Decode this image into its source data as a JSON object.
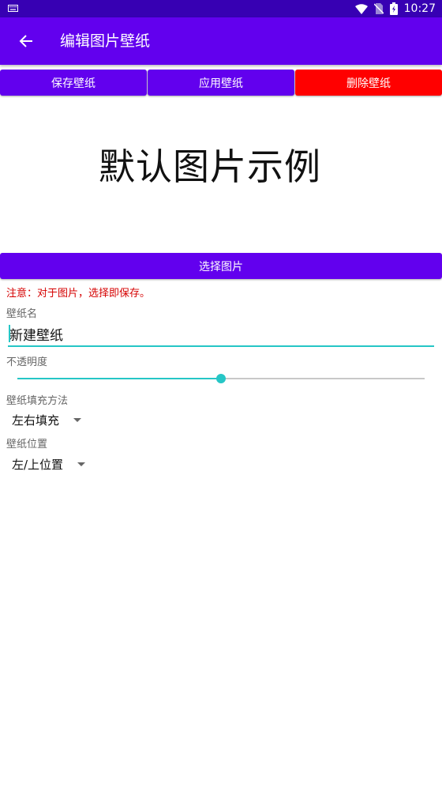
{
  "status_bar": {
    "time": "10:27",
    "icons": [
      "keyboard-icon",
      "wifi-icon",
      "no-sim-icon",
      "battery-icon"
    ]
  },
  "app_bar": {
    "title": "编辑图片壁纸",
    "back_icon": "arrow-left-icon"
  },
  "actions": {
    "save": "保存壁纸",
    "apply": "应用壁纸",
    "delete": "删除壁纸"
  },
  "preview": {
    "text": "默认图片示例"
  },
  "select_image_label": "选择图片",
  "note": "注意：对于图片，选择即保存。",
  "form": {
    "name_label": "壁纸名",
    "name_value": "新建壁纸",
    "opacity_label": "不透明度",
    "opacity_value": 0.5,
    "fill_label": "壁纸填充方法",
    "fill_value": "左右填充",
    "position_label": "壁纸位置",
    "position_value": "左/上位置"
  },
  "colors": {
    "status_bar": "#3700b3",
    "primary": "#6200ee",
    "danger": "#ff0000",
    "accent": "#26c6c6",
    "note": "#d50000"
  }
}
